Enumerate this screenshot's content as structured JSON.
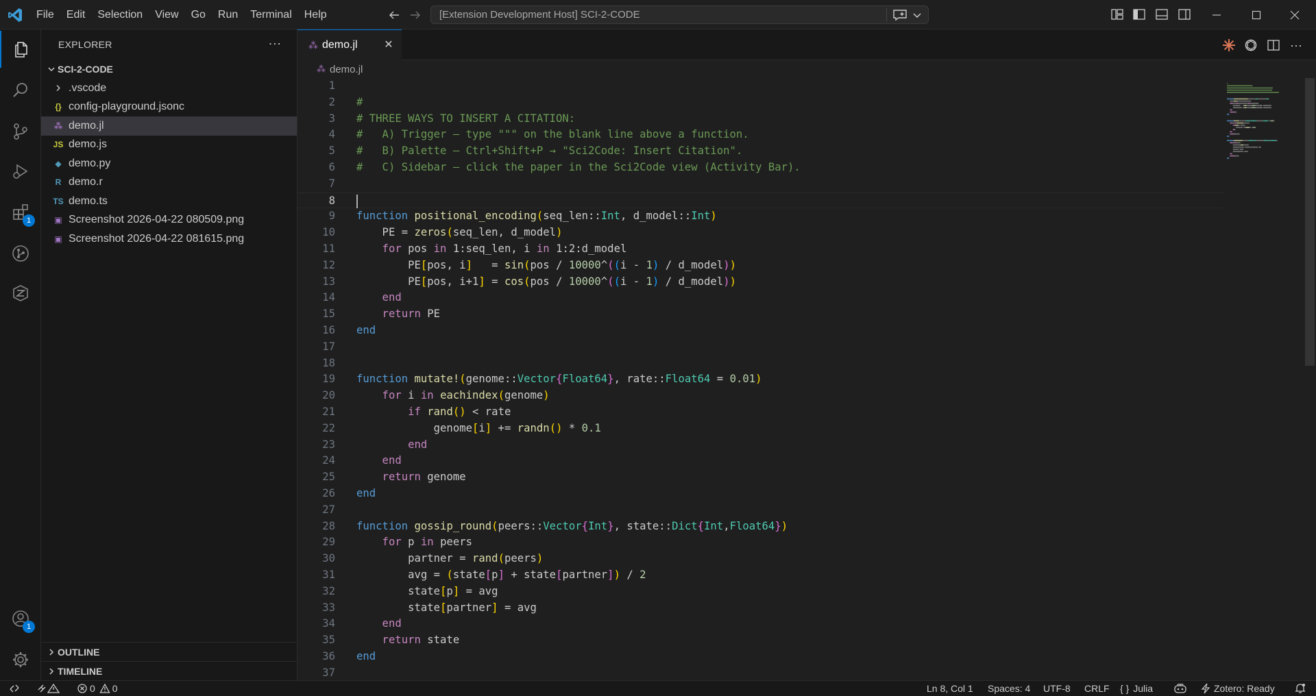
{
  "menu": [
    "File",
    "Edit",
    "Selection",
    "View",
    "Go",
    "Run",
    "Terminal",
    "Help"
  ],
  "command_center": {
    "text": "[Extension Development Host] SCI-2-CODE"
  },
  "sidebar": {
    "title": "EXPLORER",
    "folder": "SCI-2-CODE",
    "items": [
      {
        "label": ".vscode",
        "icon": "chevron-right-icon",
        "glyph": "›",
        "color": "#cccccc"
      },
      {
        "label": "config-playground.jsonc",
        "icon": "json-file-icon",
        "glyph": "{}",
        "color": "#cbcb41"
      },
      {
        "label": "demo.jl",
        "icon": "julia-file-icon",
        "glyph": "⁂",
        "color": "#a270ba"
      },
      {
        "label": "demo.js",
        "icon": "js-file-icon",
        "glyph": "JS",
        "color": "#cbcb41"
      },
      {
        "label": "demo.py",
        "icon": "python-file-icon",
        "glyph": "◆",
        "color": "#519aba"
      },
      {
        "label": "demo.r",
        "icon": "r-file-icon",
        "glyph": "R",
        "color": "#519aba"
      },
      {
        "label": "demo.ts",
        "icon": "ts-file-icon",
        "glyph": "TS",
        "color": "#519aba"
      },
      {
        "label": "Screenshot 2026-04-22 080509.png",
        "icon": "image-file-icon",
        "glyph": "▣",
        "color": "#a074c4"
      },
      {
        "label": "Screenshot 2026-04-22 081615.png",
        "icon": "image-file-icon",
        "glyph": "▣",
        "color": "#a074c4"
      }
    ],
    "selected_index": 2,
    "outline": "OUTLINE",
    "timeline": "TIMELINE"
  },
  "activity": {
    "extensions_badge": "1",
    "accounts_badge": "1"
  },
  "tab": {
    "label": "demo.jl"
  },
  "breadcrumb": {
    "file": "demo.jl"
  },
  "editor": {
    "current_line": 8,
    "lines": [
      [],
      [
        [
          "cm",
          "#"
        ]
      ],
      [
        [
          "cm",
          "# THREE WAYS TO INSERT A CITATION:"
        ]
      ],
      [
        [
          "cm",
          "#   A) Trigger — type \"\"\" on the blank line above a function."
        ]
      ],
      [
        [
          "cm",
          "#   B) Palette — Ctrl+Shift+P → \"Sci2Code: Insert Citation\"."
        ]
      ],
      [
        [
          "cm",
          "#   C) Sidebar — click the paper in the Sci2Code view (Activity Bar)."
        ]
      ],
      [],
      [],
      [
        [
          "kw2",
          "function "
        ],
        [
          "fn",
          "positional_encoding"
        ],
        [
          "b1",
          "("
        ],
        [
          "var",
          "seq_len::"
        ],
        [
          "ty",
          "Int"
        ],
        [
          "var",
          ", d_model::"
        ],
        [
          "ty",
          "Int"
        ],
        [
          "b1",
          ")"
        ]
      ],
      [
        [
          "var",
          "    PE = "
        ],
        [
          "fn",
          "zeros"
        ],
        [
          "b1",
          "("
        ],
        [
          "var",
          "seq_len, d_model"
        ],
        [
          "b1",
          ")"
        ]
      ],
      [
        [
          "kw",
          "    for "
        ],
        [
          "var",
          "pos "
        ],
        [
          "kw",
          "in "
        ],
        [
          "var",
          "1:seq_len, i "
        ],
        [
          "kw",
          "in "
        ],
        [
          "var",
          "1:2:d_model"
        ]
      ],
      [
        [
          "var",
          "        PE"
        ],
        [
          "b1",
          "["
        ],
        [
          "var",
          "pos, i"
        ],
        [
          "b1",
          "]"
        ],
        [
          "var",
          "   = "
        ],
        [
          "fn",
          "sin"
        ],
        [
          "b1",
          "("
        ],
        [
          "var",
          "pos / "
        ],
        [
          "num",
          "10000"
        ],
        [
          "var",
          "^"
        ],
        [
          "b2",
          "("
        ],
        [
          "b3",
          "("
        ],
        [
          "var",
          "i - "
        ],
        [
          "num",
          "1"
        ],
        [
          "b3",
          ")"
        ],
        [
          "var",
          " / d_model"
        ],
        [
          "b2",
          ")"
        ],
        [
          "b1",
          ")"
        ]
      ],
      [
        [
          "var",
          "        PE"
        ],
        [
          "b1",
          "["
        ],
        [
          "var",
          "pos, i+1"
        ],
        [
          "b1",
          "]"
        ],
        [
          "var",
          " = "
        ],
        [
          "fn",
          "cos"
        ],
        [
          "b1",
          "("
        ],
        [
          "var",
          "pos / "
        ],
        [
          "num",
          "10000"
        ],
        [
          "var",
          "^"
        ],
        [
          "b2",
          "("
        ],
        [
          "b3",
          "("
        ],
        [
          "var",
          "i - "
        ],
        [
          "num",
          "1"
        ],
        [
          "b3",
          ")"
        ],
        [
          "var",
          " / d_model"
        ],
        [
          "b2",
          ")"
        ],
        [
          "b1",
          ")"
        ]
      ],
      [
        [
          "kw",
          "    end"
        ]
      ],
      [
        [
          "kw",
          "    return "
        ],
        [
          "var",
          "PE"
        ]
      ],
      [
        [
          "kw2",
          "end"
        ]
      ],
      [],
      [],
      [
        [
          "kw2",
          "function "
        ],
        [
          "fn",
          "mutate!"
        ],
        [
          "b1",
          "("
        ],
        [
          "var",
          "genome::"
        ],
        [
          "ty",
          "Vector"
        ],
        [
          "b2",
          "{"
        ],
        [
          "ty",
          "Float64"
        ],
        [
          "b2",
          "}"
        ],
        [
          "var",
          ", rate::"
        ],
        [
          "ty",
          "Float64"
        ],
        [
          "var",
          " = "
        ],
        [
          "num",
          "0.01"
        ],
        [
          "b1",
          ")"
        ]
      ],
      [
        [
          "kw",
          "    for "
        ],
        [
          "var",
          "i "
        ],
        [
          "kw",
          "in "
        ],
        [
          "fn",
          "eachindex"
        ],
        [
          "b1",
          "("
        ],
        [
          "var",
          "genome"
        ],
        [
          "b1",
          ")"
        ]
      ],
      [
        [
          "kw",
          "        if "
        ],
        [
          "fn",
          "rand"
        ],
        [
          "b1",
          "()"
        ],
        [
          "var",
          " < rate"
        ]
      ],
      [
        [
          "var",
          "            genome"
        ],
        [
          "b1",
          "["
        ],
        [
          "var",
          "i"
        ],
        [
          "b1",
          "]"
        ],
        [
          "var",
          " += "
        ],
        [
          "fn",
          "randn"
        ],
        [
          "b1",
          "()"
        ],
        [
          "var",
          " * "
        ],
        [
          "num",
          "0.1"
        ]
      ],
      [
        [
          "kw",
          "        end"
        ]
      ],
      [
        [
          "kw",
          "    end"
        ]
      ],
      [
        [
          "kw",
          "    return "
        ],
        [
          "var",
          "genome"
        ]
      ],
      [
        [
          "kw2",
          "end"
        ]
      ],
      [],
      [
        [
          "kw2",
          "function "
        ],
        [
          "fn",
          "gossip_round"
        ],
        [
          "b1",
          "("
        ],
        [
          "var",
          "peers::"
        ],
        [
          "ty",
          "Vector"
        ],
        [
          "b2",
          "{"
        ],
        [
          "ty",
          "Int"
        ],
        [
          "b2",
          "}"
        ],
        [
          "var",
          ", state::"
        ],
        [
          "ty",
          "Dict"
        ],
        [
          "b2",
          "{"
        ],
        [
          "ty",
          "Int"
        ],
        [
          "var",
          ","
        ],
        [
          "ty",
          "Float64"
        ],
        [
          "b2",
          "}"
        ],
        [
          "b1",
          ")"
        ]
      ],
      [
        [
          "kw",
          "    for "
        ],
        [
          "var",
          "p "
        ],
        [
          "kw",
          "in "
        ],
        [
          "var",
          "peers"
        ]
      ],
      [
        [
          "var",
          "        partner = "
        ],
        [
          "fn",
          "rand"
        ],
        [
          "b1",
          "("
        ],
        [
          "var",
          "peers"
        ],
        [
          "b1",
          ")"
        ]
      ],
      [
        [
          "var",
          "        avg = "
        ],
        [
          "b1",
          "("
        ],
        [
          "var",
          "state"
        ],
        [
          "b2",
          "["
        ],
        [
          "var",
          "p"
        ],
        [
          "b2",
          "]"
        ],
        [
          "var",
          " + state"
        ],
        [
          "b2",
          "["
        ],
        [
          "var",
          "partner"
        ],
        [
          "b2",
          "]"
        ],
        [
          "b1",
          ")"
        ],
        [
          "var",
          " / "
        ],
        [
          "num",
          "2"
        ]
      ],
      [
        [
          "var",
          "        state"
        ],
        [
          "b1",
          "["
        ],
        [
          "var",
          "p"
        ],
        [
          "b1",
          "]"
        ],
        [
          "var",
          " = avg"
        ]
      ],
      [
        [
          "var",
          "        state"
        ],
        [
          "b1",
          "["
        ],
        [
          "var",
          "partner"
        ],
        [
          "b1",
          "]"
        ],
        [
          "var",
          " = avg"
        ]
      ],
      [
        [
          "kw",
          "    end"
        ]
      ],
      [
        [
          "kw",
          "    return "
        ],
        [
          "var",
          "state"
        ]
      ],
      [
        [
          "kw2",
          "end"
        ]
      ],
      []
    ]
  },
  "status": {
    "errors": "0",
    "warnings": "0",
    "position": "Ln 8, Col 1",
    "spaces": "Spaces: 4",
    "encoding": "UTF-8",
    "eol": "CRLF",
    "language_glyph": "{ }",
    "language": "Julia",
    "zotero": "Zotero: Ready"
  }
}
